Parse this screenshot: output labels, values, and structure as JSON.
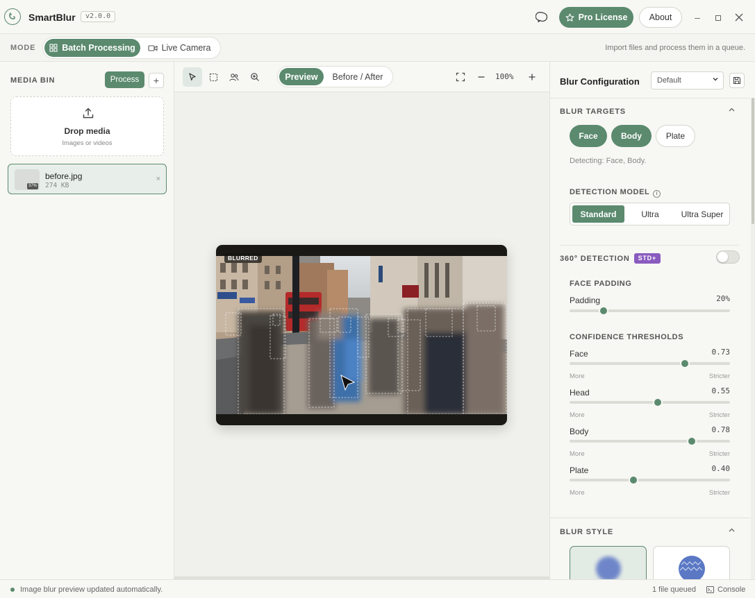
{
  "app": {
    "name": "SmartBlur",
    "version": "v2.0.0",
    "pro_label": "Pro License",
    "about_label": "About",
    "accent_color": "#5b8a6e"
  },
  "mode": {
    "label": "MODE",
    "tabs": [
      "Batch Processing",
      "Live Camera"
    ],
    "active_tab": "Batch Processing",
    "hint": "Import files and process them in a queue."
  },
  "media_bin": {
    "title": "MEDIA BIN",
    "process_label": "Process",
    "add_label": "+",
    "dropzone_title": "Drop media",
    "dropzone_subtitle": "Images or videos",
    "files": [
      {
        "name": "before.jpg",
        "size": "274 KB",
        "badge": "37%",
        "close": "×"
      }
    ]
  },
  "canvas": {
    "view_tabs": [
      "Preview",
      "Before / After"
    ],
    "active_view": "Preview",
    "zoom": "100%",
    "overlay_tag": "BLURRED"
  },
  "config": {
    "title": "Blur Configuration",
    "preset": "Default",
    "targets": {
      "title": "BLUR TARGETS",
      "options": [
        {
          "label": "Face",
          "on": true
        },
        {
          "label": "Body",
          "on": true
        },
        {
          "label": "Plate",
          "on": false
        }
      ],
      "detecting_text": "Detecting: Face, Body."
    },
    "model": {
      "title": "DETECTION MODEL",
      "info_icon": "i",
      "options": [
        "Standard",
        "Ultra",
        "Ultra Super"
      ],
      "selected": "Standard"
    },
    "detection_360": {
      "title": "360° DETECTION",
      "badge": "STD+",
      "enabled": false
    },
    "face_padding": {
      "title": "FACE PADDING",
      "label": "Padding",
      "value": "20%",
      "fraction": 0.21
    },
    "confidence": {
      "title": "CONFIDENCE THRESHOLDS",
      "less_label": "More",
      "more_label": "Stricter",
      "thresholds": [
        {
          "label": "Face",
          "value": "0.73",
          "fraction": 0.72
        },
        {
          "label": "Head",
          "value": "0.55",
          "fraction": 0.55
        },
        {
          "label": "Body",
          "value": "0.78",
          "fraction": 0.76
        },
        {
          "label": "Plate",
          "value": "0.40",
          "fraction": 0.4
        }
      ]
    },
    "blur_style": {
      "title": "BLUR STYLE"
    }
  },
  "status": {
    "text": "Image blur preview updated automatically.",
    "queue": "1 file queued",
    "console_label": "Console"
  }
}
